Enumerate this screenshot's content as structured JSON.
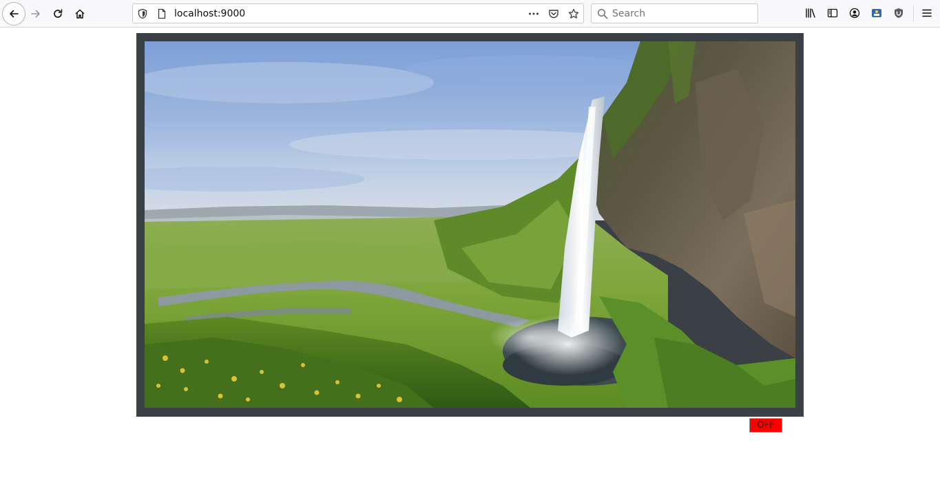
{
  "browser": {
    "url": "localhost:9000",
    "search_placeholder": "Search",
    "icons": {
      "back": "back-arrow-icon",
      "forward": "forward-arrow-icon",
      "reload": "reload-icon",
      "home": "home-icon",
      "site_info": "tracking-shield-icon",
      "page": "page-icon",
      "more": "more-actions-icon",
      "pocket": "pocket-icon",
      "bookmark": "star-icon",
      "search": "search-icon",
      "library": "library-icon",
      "sidebar": "sidebar-icon",
      "account": "account-icon",
      "extension_1": "extension-icon",
      "extension_2": "ublock-icon",
      "menu": "hamburger-menu-icon"
    }
  },
  "viewer": {
    "image_subject": "waterfall landscape",
    "frame_color": "#3b3f46",
    "toggle": {
      "label": "OFF",
      "color": "#ff0000"
    }
  }
}
